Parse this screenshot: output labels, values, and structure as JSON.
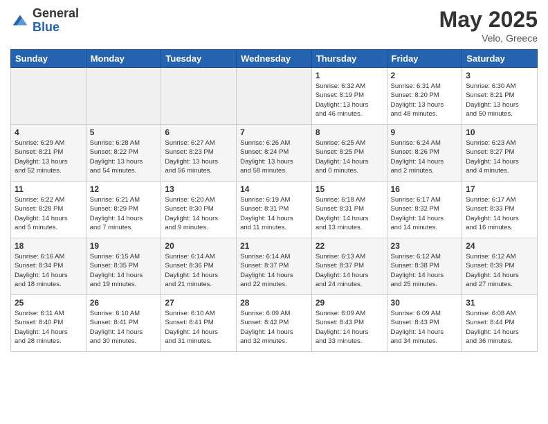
{
  "header": {
    "logo_general": "General",
    "logo_blue": "Blue",
    "month_title": "May 2025",
    "subtitle": "Velo, Greece"
  },
  "days_of_week": [
    "Sunday",
    "Monday",
    "Tuesday",
    "Wednesday",
    "Thursday",
    "Friday",
    "Saturday"
  ],
  "weeks": [
    [
      {
        "day": "",
        "info": ""
      },
      {
        "day": "",
        "info": ""
      },
      {
        "day": "",
        "info": ""
      },
      {
        "day": "",
        "info": ""
      },
      {
        "day": "1",
        "info": "Sunrise: 6:32 AM\nSunset: 8:19 PM\nDaylight: 13 hours\nand 46 minutes."
      },
      {
        "day": "2",
        "info": "Sunrise: 6:31 AM\nSunset: 8:20 PM\nDaylight: 13 hours\nand 48 minutes."
      },
      {
        "day": "3",
        "info": "Sunrise: 6:30 AM\nSunset: 8:21 PM\nDaylight: 13 hours\nand 50 minutes."
      }
    ],
    [
      {
        "day": "4",
        "info": "Sunrise: 6:29 AM\nSunset: 8:21 PM\nDaylight: 13 hours\nand 52 minutes."
      },
      {
        "day": "5",
        "info": "Sunrise: 6:28 AM\nSunset: 8:22 PM\nDaylight: 13 hours\nand 54 minutes."
      },
      {
        "day": "6",
        "info": "Sunrise: 6:27 AM\nSunset: 8:23 PM\nDaylight: 13 hours\nand 56 minutes."
      },
      {
        "day": "7",
        "info": "Sunrise: 6:26 AM\nSunset: 8:24 PM\nDaylight: 13 hours\nand 58 minutes."
      },
      {
        "day": "8",
        "info": "Sunrise: 6:25 AM\nSunset: 8:25 PM\nDaylight: 14 hours\nand 0 minutes."
      },
      {
        "day": "9",
        "info": "Sunrise: 6:24 AM\nSunset: 8:26 PM\nDaylight: 14 hours\nand 2 minutes."
      },
      {
        "day": "10",
        "info": "Sunrise: 6:23 AM\nSunset: 8:27 PM\nDaylight: 14 hours\nand 4 minutes."
      }
    ],
    [
      {
        "day": "11",
        "info": "Sunrise: 6:22 AM\nSunset: 8:28 PM\nDaylight: 14 hours\nand 5 minutes."
      },
      {
        "day": "12",
        "info": "Sunrise: 6:21 AM\nSunset: 8:29 PM\nDaylight: 14 hours\nand 7 minutes."
      },
      {
        "day": "13",
        "info": "Sunrise: 6:20 AM\nSunset: 8:30 PM\nDaylight: 14 hours\nand 9 minutes."
      },
      {
        "day": "14",
        "info": "Sunrise: 6:19 AM\nSunset: 8:31 PM\nDaylight: 14 hours\nand 11 minutes."
      },
      {
        "day": "15",
        "info": "Sunrise: 6:18 AM\nSunset: 8:31 PM\nDaylight: 14 hours\nand 13 minutes."
      },
      {
        "day": "16",
        "info": "Sunrise: 6:17 AM\nSunset: 8:32 PM\nDaylight: 14 hours\nand 14 minutes."
      },
      {
        "day": "17",
        "info": "Sunrise: 6:17 AM\nSunset: 8:33 PM\nDaylight: 14 hours\nand 16 minutes."
      }
    ],
    [
      {
        "day": "18",
        "info": "Sunrise: 6:16 AM\nSunset: 8:34 PM\nDaylight: 14 hours\nand 18 minutes."
      },
      {
        "day": "19",
        "info": "Sunrise: 6:15 AM\nSunset: 8:35 PM\nDaylight: 14 hours\nand 19 minutes."
      },
      {
        "day": "20",
        "info": "Sunrise: 6:14 AM\nSunset: 8:36 PM\nDaylight: 14 hours\nand 21 minutes."
      },
      {
        "day": "21",
        "info": "Sunrise: 6:14 AM\nSunset: 8:37 PM\nDaylight: 14 hours\nand 22 minutes."
      },
      {
        "day": "22",
        "info": "Sunrise: 6:13 AM\nSunset: 8:37 PM\nDaylight: 14 hours\nand 24 minutes."
      },
      {
        "day": "23",
        "info": "Sunrise: 6:12 AM\nSunset: 8:38 PM\nDaylight: 14 hours\nand 25 minutes."
      },
      {
        "day": "24",
        "info": "Sunrise: 6:12 AM\nSunset: 8:39 PM\nDaylight: 14 hours\nand 27 minutes."
      }
    ],
    [
      {
        "day": "25",
        "info": "Sunrise: 6:11 AM\nSunset: 8:40 PM\nDaylight: 14 hours\nand 28 minutes."
      },
      {
        "day": "26",
        "info": "Sunrise: 6:10 AM\nSunset: 8:41 PM\nDaylight: 14 hours\nand 30 minutes."
      },
      {
        "day": "27",
        "info": "Sunrise: 6:10 AM\nSunset: 8:41 PM\nDaylight: 14 hours\nand 31 minutes."
      },
      {
        "day": "28",
        "info": "Sunrise: 6:09 AM\nSunset: 8:42 PM\nDaylight: 14 hours\nand 32 minutes."
      },
      {
        "day": "29",
        "info": "Sunrise: 6:09 AM\nSunset: 8:43 PM\nDaylight: 14 hours\nand 33 minutes."
      },
      {
        "day": "30",
        "info": "Sunrise: 6:09 AM\nSunset: 8:43 PM\nDaylight: 14 hours\nand 34 minutes."
      },
      {
        "day": "31",
        "info": "Sunrise: 6:08 AM\nSunset: 8:44 PM\nDaylight: 14 hours\nand 36 minutes."
      }
    ]
  ]
}
